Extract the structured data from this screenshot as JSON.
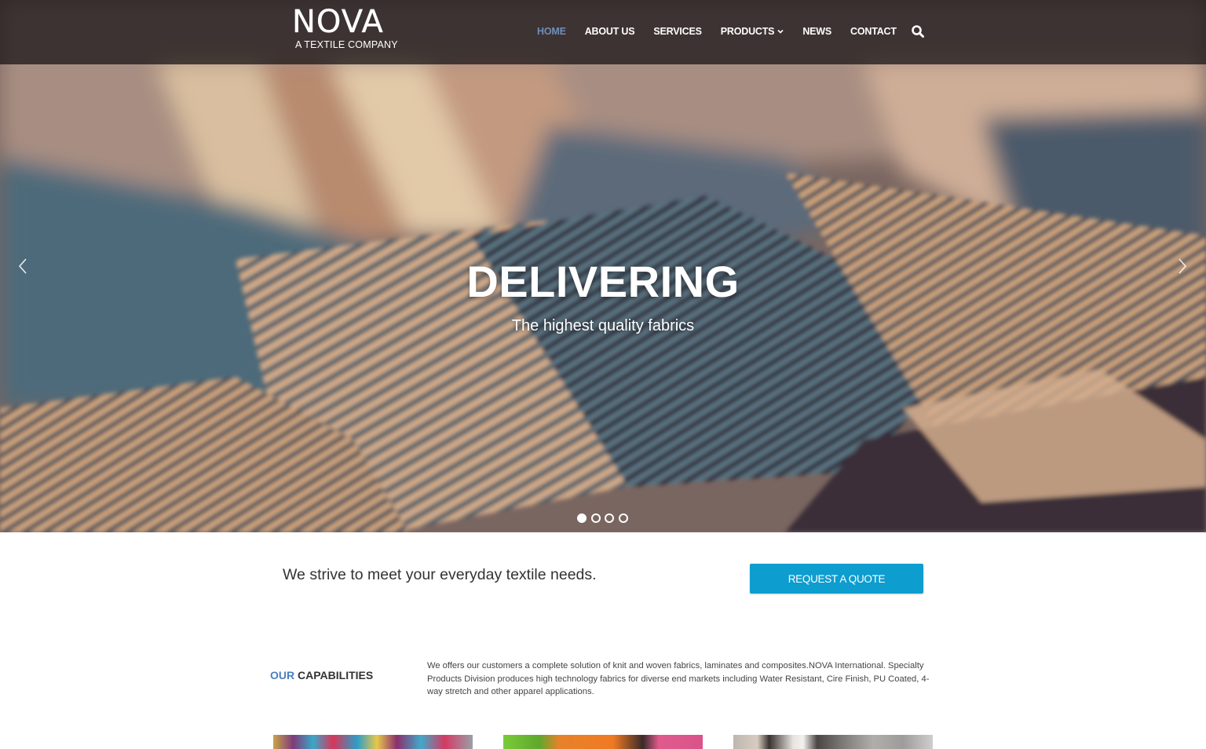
{
  "header": {
    "logo_main": "NOVA",
    "logo_sub": "A TEXTILE COMPANY",
    "nav": [
      {
        "label": "HOME",
        "active": true
      },
      {
        "label": "ABOUT US",
        "active": false
      },
      {
        "label": "SERVICES",
        "active": false
      },
      {
        "label": "PRODUCTS",
        "active": false,
        "dropdown": true
      },
      {
        "label": "NEWS",
        "active": false
      },
      {
        "label": "CONTACT",
        "active": false
      }
    ],
    "search_icon": "search-icon"
  },
  "hero": {
    "title": "DELIVERING",
    "subtitle": "The highest quality fabrics",
    "slides_total": 4,
    "active_slide": 1,
    "prev_icon": "chevron-left-icon",
    "next_icon": "chevron-right-icon"
  },
  "tagline": {
    "text": "We strive to meet your everyday textile needs.",
    "button_label": "REQUEST A QUOTE"
  },
  "capabilities": {
    "title_our": "OUR",
    "title_rest": "CAPABILITIES",
    "description": "We offers our customers a complete solution of knit and woven fabrics, laminates and composites.NOVA International. Specialty Products Division produces high technology fabrics for diverse end markets including Water Resistant, Cire Finish, PU Coated, 4-way stretch and other apparel applications."
  },
  "colors": {
    "accent_blue": "#0d9dcf",
    "nav_active": "#6f8fb8",
    "heading_blue": "#4a7fc1"
  }
}
